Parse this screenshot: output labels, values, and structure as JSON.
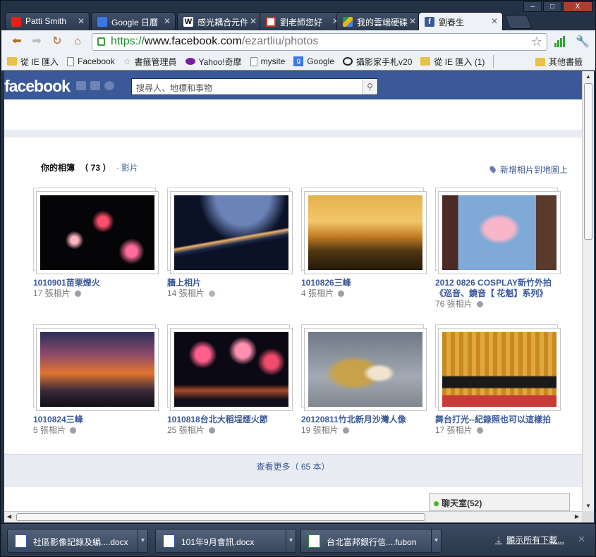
{
  "window": {
    "controls": [
      "–",
      "□",
      "X"
    ]
  },
  "tabs": [
    {
      "label": "Patti Smith",
      "icon": "youtube-icon",
      "color": "#e62117"
    },
    {
      "label": "Google 日曆",
      "icon": "calendar-icon",
      "color": "#3b78e7"
    },
    {
      "label": "感光耦合元件",
      "icon": "wikipedia-icon",
      "color": "#ffffff"
    },
    {
      "label": "劉老師您好",
      "icon": "gmail-icon",
      "color": "#d93025"
    },
    {
      "label": "我的雲端硬碟",
      "icon": "drive-icon",
      "color": "#f4b400"
    },
    {
      "label": "劉春生",
      "icon": "facebook-icon",
      "color": "#3b5998",
      "active": true
    }
  ],
  "omnibox": {
    "scheme": "https://",
    "host": "www.facebook.com",
    "path": "/ezartliu/photos"
  },
  "bookmarks": [
    {
      "label": "從 IE 匯入",
      "icon": "folder"
    },
    {
      "label": "Facebook",
      "icon": "page"
    },
    {
      "label": "書籤管理員",
      "icon": "star"
    },
    {
      "label": "Yahoo!奇摩",
      "icon": "yahoo"
    },
    {
      "label": "mysite",
      "icon": "page"
    },
    {
      "label": "Google",
      "icon": "goog"
    },
    {
      "label": "攝影家手札v20",
      "icon": "cam"
    },
    {
      "label": "從 IE 匯入 (1)",
      "icon": "folder"
    }
  ],
  "bookmarks_more": "其他書籤",
  "facebook": {
    "logo": "facebook",
    "search_placeholder": "搜尋人、地標和事物",
    "albums_title": "你的相簿",
    "albums_count": "（ 73 ）",
    "videos_link": "· 影片",
    "add_to_map": "新增相片到地圖上",
    "albums": [
      {
        "title": "1010901苗栗煙火",
        "count": "17 張相片",
        "privacy": "globe"
      },
      {
        "title": "牆上相片",
        "count": "14 張相片",
        "privacy": "gear"
      },
      {
        "title": "1010826三峰",
        "count": "4 張相片",
        "privacy": "globe"
      },
      {
        "title": "2012 0826 COSPLAY新竹外拍《巡音、鏡音【 花魁】系列》",
        "count": "76 張相片",
        "privacy": "globe"
      },
      {
        "title": "1010824三峰",
        "count": "5 張相片",
        "privacy": "globe"
      },
      {
        "title": "1010818台北大稻埕煙火節",
        "count": "25 張相片",
        "privacy": "globe"
      },
      {
        "title": "20120811竹北新月沙灣人像",
        "count": "19 張相片",
        "privacy": "globe"
      },
      {
        "title": "舞台打光--紀錄照也可以這樣拍",
        "count": "17 張相片",
        "privacy": "globe"
      }
    ],
    "see_more": "查看更多（ 65 本）",
    "chat_label": "聊天室",
    "chat_count": "(52)"
  },
  "downloads": [
    {
      "name": "社區影像記錄及編....docx",
      "type": "word"
    },
    {
      "name": "101年9月會訊.docx",
      "type": "word"
    },
    {
      "name": "台北富邦銀行信....fubon",
      "type": "xls"
    }
  ],
  "show_all_downloads": "顯示所有下載...",
  "colors": {
    "facebook_blue": "#3b5998",
    "chrome_frame": "#243245",
    "secure_green": "#1d8a2a"
  }
}
